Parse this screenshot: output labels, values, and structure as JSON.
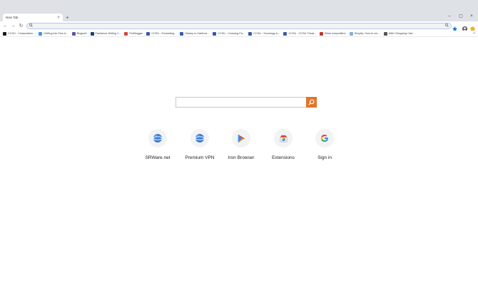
{
  "tab": {
    "title": "New Tab",
    "close": "×"
  },
  "new_tab_label": "+",
  "window_controls": {
    "minimize": "–",
    "maximize": "▢",
    "close": "×"
  },
  "nav": {
    "back": "←",
    "forward": "→",
    "reload": "↻"
  },
  "omnibox": {
    "icon": "search-icon",
    "value": ""
  },
  "bookmarks": [
    {
      "label": "CCSU - Composition...",
      "color": "#1a1a1a"
    },
    {
      "label": "Drifting into Few &...",
      "color": "#4a90d9"
    },
    {
      "label": "Blognutt",
      "color": "#6b4fa0"
    },
    {
      "label": "Freelance Writing J...",
      "color": "#1d3f73"
    },
    {
      "label": "ProBlogger",
      "color": "#d0463b"
    },
    {
      "label": "CCSU - Exceeding...",
      "color": "#3d5aa8"
    },
    {
      "label": "History in Hartford...",
      "color": "#3d5aa8"
    },
    {
      "label": "CCSU - Crossing Pa...",
      "color": "#3d5aa8"
    },
    {
      "label": "CCSU - Sociology &...",
      "color": "#3d5aa8"
    },
    {
      "label": "CCSU - CCSU Theat...",
      "color": "#3d5aa8"
    },
    {
      "label": "Brine competition",
      "color": "#c0392b"
    },
    {
      "label": "Shopify: How to cre...",
      "color": "#7fb0d8"
    },
    {
      "label": "M&H Shopping Cart...",
      "color": "#555555"
    }
  ],
  "bookmarks_more": "»",
  "shortcuts": [
    {
      "label": "SRWare.net",
      "icon": "globe-icon"
    },
    {
      "label": "Premium VPN",
      "icon": "globe-icon"
    },
    {
      "label": "Iron Browser",
      "icon": "play-store-icon"
    },
    {
      "label": "Extensions",
      "icon": "store-icon"
    },
    {
      "label": "Sign in",
      "icon": "google-icon"
    }
  ],
  "colors": {
    "search_button": "#e3742b",
    "tab_strip": "#dee1e6"
  }
}
